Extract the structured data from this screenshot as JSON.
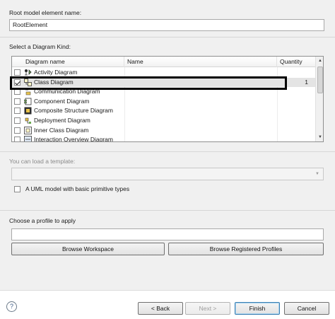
{
  "root": {
    "label": "Root model element name:",
    "value": "RootElement"
  },
  "diagram_kind": {
    "label": "Select a Diagram Kind:",
    "columns": [
      "Diagram name",
      "Name",
      "Quantity"
    ],
    "rows": [
      {
        "name": "Activity Diagram",
        "icon": "activity-diagram-icon",
        "checked": false,
        "quantity": ""
      },
      {
        "name": "Class Diagram",
        "icon": "class-diagram-icon",
        "checked": true,
        "quantity": "1"
      },
      {
        "name": "Communication Diagram",
        "icon": "communication-diagram-icon",
        "checked": false,
        "quantity": ""
      },
      {
        "name": "Component Diagram",
        "icon": "component-diagram-icon",
        "checked": false,
        "quantity": ""
      },
      {
        "name": "Composite Structure Diagram",
        "icon": "composite-structure-diagram-icon",
        "checked": false,
        "quantity": ""
      },
      {
        "name": "Deployment Diagram",
        "icon": "deployment-diagram-icon",
        "checked": false,
        "quantity": ""
      },
      {
        "name": "Inner Class Diagram",
        "icon": "inner-class-diagram-icon",
        "checked": false,
        "quantity": ""
      },
      {
        "name": "Interaction Overview Diagram",
        "icon": "interaction-overview-diagram-icon",
        "checked": false,
        "quantity": ""
      }
    ]
  },
  "template": {
    "label": "You can load a template:",
    "combo_value": "",
    "option": {
      "label": "A UML model with basic primitive types",
      "checked": false
    }
  },
  "profile": {
    "label": "Choose a profile to apply",
    "value": "",
    "browse_workspace": "Browse Workspace",
    "browse_registered": "Browse Registered Profiles"
  },
  "footer": {
    "help": "?",
    "back": "< Back",
    "next": "Next >",
    "finish": "Finish",
    "cancel": "Cancel"
  }
}
